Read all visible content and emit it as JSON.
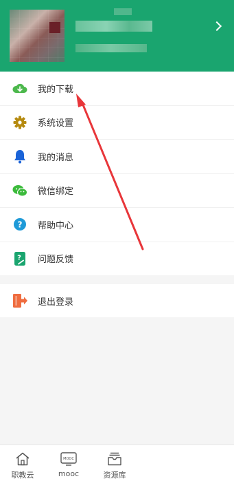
{
  "menu": {
    "items": [
      {
        "label": "我的下载",
        "icon": "download-cloud-icon"
      },
      {
        "label": "系统设置",
        "icon": "gear-icon"
      },
      {
        "label": "我的消息",
        "icon": "bell-icon"
      },
      {
        "label": "微信绑定",
        "icon": "wechat-icon"
      },
      {
        "label": "帮助中心",
        "icon": "help-icon"
      },
      {
        "label": "问题反馈",
        "icon": "feedback-icon"
      }
    ],
    "logout_label": "退出登录"
  },
  "tabbar": {
    "tabs": [
      {
        "label": "职教云",
        "icon": "home-icon"
      },
      {
        "label": "mooc",
        "icon": "mooc-icon",
        "icon_text": "MOOC"
      },
      {
        "label": "资源库",
        "icon": "resource-library-icon"
      }
    ]
  },
  "colors": {
    "header_bg": "#1aa56f",
    "download_icon": "#4cb84c",
    "settings_icon": "#b58a10",
    "message_icon": "#1a63d8",
    "wechat_icon": "#3cbb3c",
    "help_icon": "#1e9ad8",
    "feedback_icon": "#1aa56f",
    "logout_icon": "#ef6c3f",
    "annotation_arrow": "#e8363a"
  }
}
